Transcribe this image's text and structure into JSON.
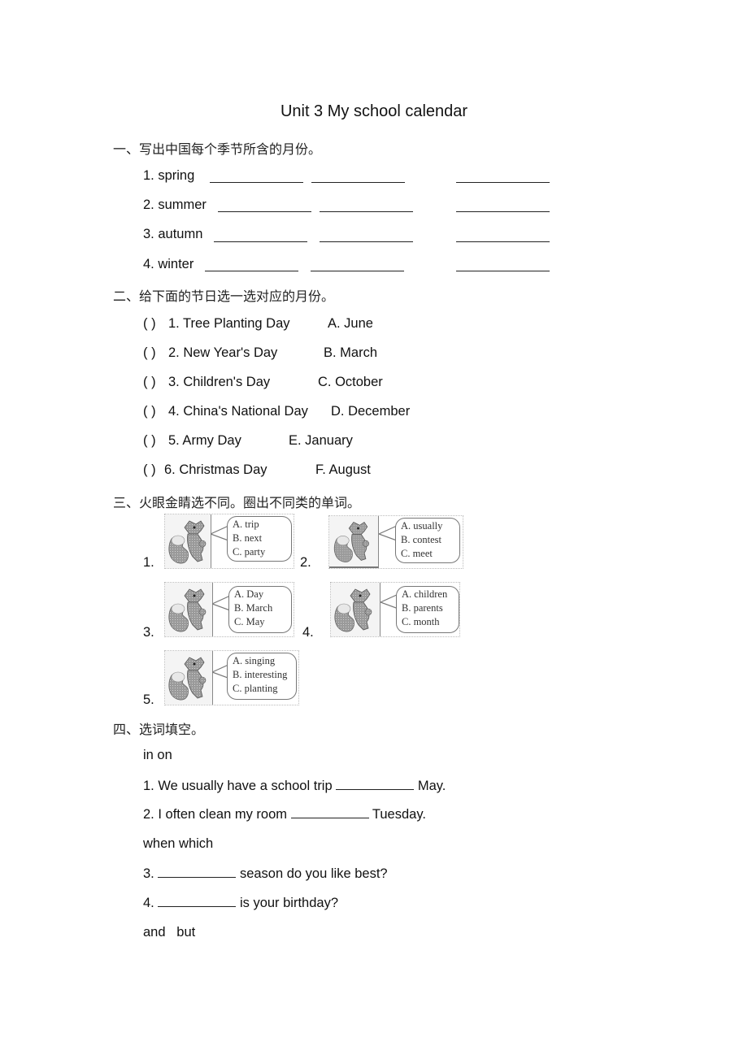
{
  "title": "Unit 3 My school calendar",
  "section1": {
    "heading": "一、写出中国每个季节所含的月份。",
    "items": [
      {
        "label": "1. spring"
      },
      {
        "label": "2. summer"
      },
      {
        "label": "3. autumn"
      },
      {
        "label": "4. winter"
      }
    ]
  },
  "section2": {
    "heading": "二、给下面的节日选一选对应的月份。",
    "items": [
      {
        "paren": "(   )",
        "text": "1. Tree Planting Day",
        "option": "A. June"
      },
      {
        "paren": "(   )",
        "text": "2. New Year's Day",
        "option": "B. March"
      },
      {
        "paren": "(   )",
        "text": "3. Children's Day",
        "option": "C. October"
      },
      {
        "paren": "(   )",
        "text": "4. China's National Day",
        "option": "D. December"
      },
      {
        "paren": "(   )",
        "text": "5. Army Day",
        "option": "E. January"
      },
      {
        "paren": "(   )",
        "text": "6. Christmas Day",
        "option": "F. August"
      }
    ]
  },
  "section3": {
    "heading": "三、火眼金睛选不同。圈出不同类的单词。",
    "items": [
      {
        "num": "1.",
        "options": [
          "A. trip",
          "B. next",
          "C. party"
        ]
      },
      {
        "num": "2.",
        "options": [
          "A. usually",
          "B. contest",
          "C. meet"
        ]
      },
      {
        "num": "3.",
        "options": [
          "A. Day",
          "B. March",
          "C. May"
        ]
      },
      {
        "num": "4.",
        "options": [
          "A. children",
          "B. parents",
          "C. month"
        ]
      },
      {
        "num": "5.",
        "options": [
          "A. singing",
          "B. interesting",
          "C. planting"
        ]
      }
    ],
    "picture_icon": "squirrel-icon"
  },
  "section4": {
    "heading": "四、选词填空。",
    "groups": [
      {
        "words": "in  on",
        "sentences": [
          {
            "before": "1. We usually have a school trip",
            "after": "May."
          },
          {
            "before": "2. I often clean my room",
            "after": "Tuesday."
          }
        ]
      },
      {
        "words": "when  which",
        "sentences": [
          {
            "before": "3.",
            "after": "season do you like best?"
          },
          {
            "before": "4.",
            "after": "is your birthday?"
          }
        ]
      },
      {
        "words": "and   but",
        "sentences": []
      }
    ]
  }
}
